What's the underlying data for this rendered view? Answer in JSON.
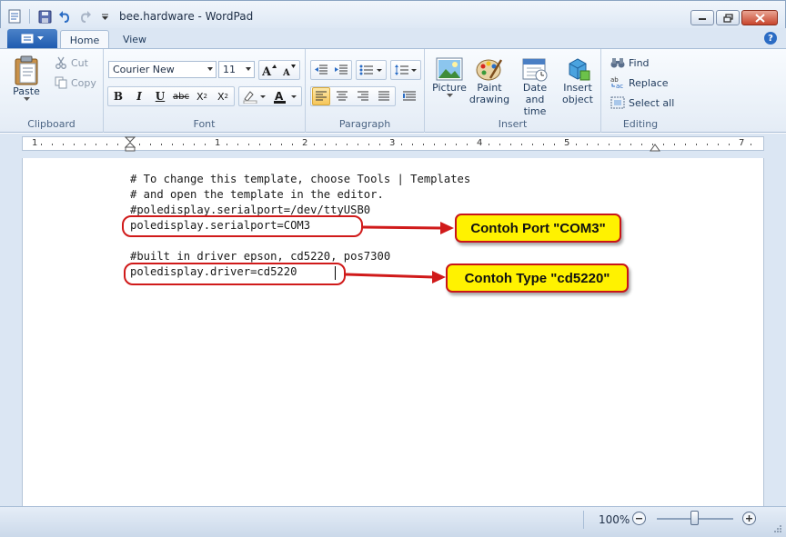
{
  "window": {
    "title": "bee.hardware - WordPad"
  },
  "tabs": {
    "home": "Home",
    "view": "View"
  },
  "clipboard": {
    "paste": "Paste",
    "cut": "Cut",
    "copy": "Copy",
    "label": "Clipboard"
  },
  "font": {
    "family": "Courier New",
    "size": "11",
    "label": "Font"
  },
  "paragraph": {
    "label": "Paragraph"
  },
  "insert": {
    "picture": "Picture",
    "paint_line1": "Paint",
    "paint_line2": "drawing",
    "datetime_line1": "Date and",
    "datetime_line2": "time",
    "object_line1": "Insert",
    "object_line2": "object",
    "label": "Insert"
  },
  "editing": {
    "find": "Find",
    "replace": "Replace",
    "select_all": "Select all",
    "label": "Editing"
  },
  "ruler": {
    "numbers": [
      "1",
      "1",
      "2",
      "3",
      "4",
      "5",
      "7"
    ]
  },
  "document": {
    "lines": [
      "# To change this template, choose Tools | Templates",
      "# and open the template in the editor.",
      "#poledisplay.serialport=/dev/ttyUSB0",
      "poledisplay.serialport=COM3",
      "",
      "#built in driver epson, cd5220, pos7300",
      "poledisplay.driver=cd5220"
    ]
  },
  "annotations": {
    "port_callout": "Contoh Port \"COM3\"",
    "type_callout": "Contoh Type \"cd5220\"",
    "color_red": "#d01a1a",
    "color_yellow": "#fff200"
  },
  "status": {
    "zoom": "100%"
  }
}
